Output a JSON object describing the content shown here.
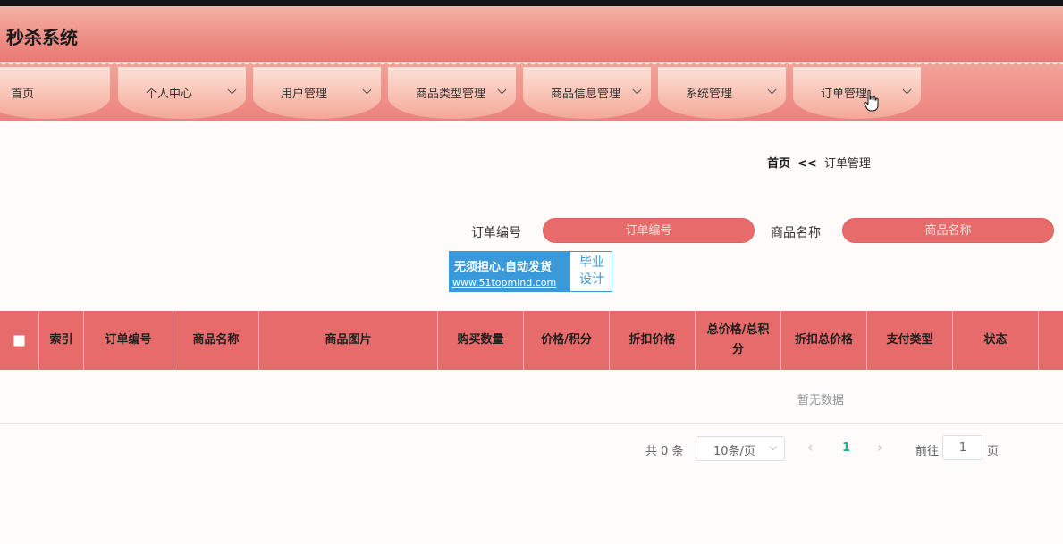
{
  "app": {
    "title": "秒杀系统"
  },
  "nav": {
    "items": [
      {
        "label": "首页",
        "has_dropdown": false
      },
      {
        "label": "个人中心",
        "has_dropdown": true
      },
      {
        "label": "用户管理",
        "has_dropdown": true
      },
      {
        "label": "商品类型管理",
        "has_dropdown": true
      },
      {
        "label": "商品信息管理",
        "has_dropdown": true
      },
      {
        "label": "系统管理",
        "has_dropdown": true
      },
      {
        "label": "订单管理",
        "has_dropdown": true
      }
    ]
  },
  "breadcrumb": {
    "home": "首页",
    "separator": "<<",
    "current": "订单管理"
  },
  "search": {
    "order_no_label": "订单编号",
    "order_no_placeholder": "订单编号",
    "product_name_label": "商品名称",
    "product_name_placeholder": "商品名称"
  },
  "watermark": {
    "line1": "无须担心.自动发货",
    "line2": "www.51topmind.com",
    "right_line1": "毕业",
    "right_line2": "设计"
  },
  "table": {
    "columns": [
      "索引",
      "订单编号",
      "商品名称",
      "商品图片",
      "购买数量",
      "价格/积分",
      "折扣价格",
      "总价格/总积分",
      "折扣总价格",
      "支付类型",
      "状态"
    ],
    "empty_text": "暂无数据"
  },
  "pagination": {
    "total_text": "共 0 条",
    "page_size": "10条/页",
    "current_page": "1",
    "goto_label": "前往",
    "goto_value": "1",
    "page_unit": "页"
  },
  "colors": {
    "header": "#ee8f86",
    "table_header": "#e86b6b",
    "search_input": "#e86b6b",
    "nav_tab": "#f9c2b4",
    "active_page": "#1bb394",
    "watermark": "#3a9ad9"
  }
}
